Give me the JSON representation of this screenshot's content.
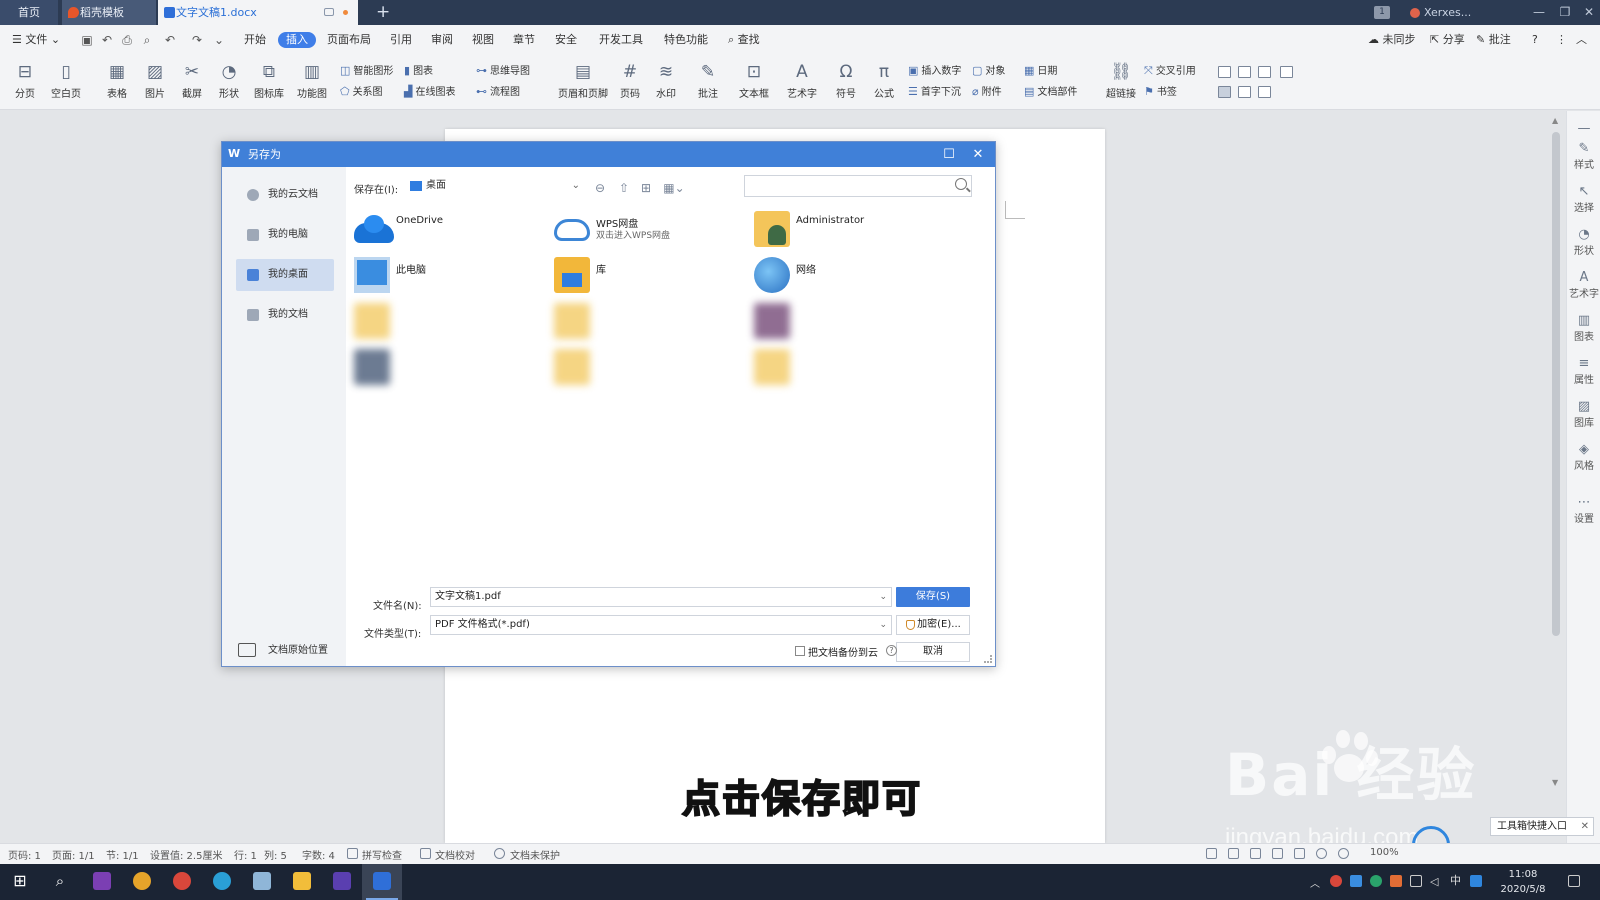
{
  "tabs": {
    "home": "首页",
    "template": "稻壳模板",
    "document": "文字文稿1.docx",
    "new_tab": "+",
    "window_count": "1",
    "user": "Xerxes..."
  },
  "menubar": {
    "file": "文件",
    "items": [
      "开始",
      "插入",
      "页面布局",
      "引用",
      "审阅",
      "视图",
      "章节",
      "安全",
      "开发工具",
      "特色功能"
    ],
    "active": "插入",
    "search": "查找",
    "sync": "未同步",
    "share": "分享",
    "comment": "批注"
  },
  "ribbon": {
    "pagebreak": "分页",
    "blankpage": "空白页",
    "table": "表格",
    "picture": "图片",
    "screenshot": "截屏",
    "shape": "形状",
    "iconlib": "图标库",
    "funcchart": "功能图",
    "smartart": "智能图形",
    "chart": "图表",
    "mindmap": "思维导图",
    "relation": "关系图",
    "onlinechart": "在线图表",
    "flowchart": "流程图",
    "headerfooter": "页眉和页脚",
    "pagenum": "页码",
    "watermark": "水印",
    "annotate": "批注",
    "textbox": "文本框",
    "wordart": "艺术字",
    "symbol": "符号",
    "formula": "公式",
    "insertnum": "插入数字",
    "object": "对象",
    "date": "日期",
    "dropcap": "首字下沉",
    "attachment": "附件",
    "docparts": "文档部件",
    "hyperlink": "超链接",
    "crossref": "交叉引用",
    "bookmark": "书签"
  },
  "sidepanel": [
    "样式",
    "选择",
    "形状",
    "艺术字",
    "图表",
    "属性",
    "图库",
    "风格",
    "设置"
  ],
  "dialog": {
    "title": "另存为",
    "sidebar": [
      "我的云文档",
      "我的电脑",
      "我的桌面",
      "我的文档"
    ],
    "sidebar_selected": "我的桌面",
    "original_location": "文档原始位置",
    "save_in_label": "保存在(I):",
    "save_in_value": "桌面",
    "items": [
      {
        "name": "OneDrive",
        "sub": ""
      },
      {
        "name": "WPS网盘",
        "sub": "双击进入WPS网盘"
      },
      {
        "name": "Administrator",
        "sub": ""
      },
      {
        "name": "此电脑",
        "sub": ""
      },
      {
        "name": "库",
        "sub": ""
      },
      {
        "name": "网络",
        "sub": ""
      }
    ],
    "filename_label": "文件名(N):",
    "filename_value": "文字文稿1.pdf",
    "filetype_label": "文件类型(T):",
    "filetype_value": "PDF 文件格式(*.pdf)",
    "save_button": "保存(S)",
    "encrypt_button": "加密(E)...",
    "cancel_button": "取消",
    "backup_checkbox": "把文档备份到云"
  },
  "caption": "点击保存即可",
  "watermark": {
    "brand": "Bai  经验",
    "url": "jingyan.baidu.com"
  },
  "toolbox_popup": "工具箱快捷入口",
  "statusbar": {
    "page": "页码: 1",
    "pages": "页面: 1/1",
    "section": "节: 1/1",
    "setting": "设置值: 2.5厘米",
    "row": "行: 1",
    "col": "列: 5",
    "words": "字数: 4",
    "spellcheck": "拼写检查",
    "proof": "文档校对",
    "protect": "文档未保护",
    "zoom": "100%"
  },
  "taskbar": {
    "time": "11:08",
    "date": "2020/5/8",
    "ime": "中"
  }
}
